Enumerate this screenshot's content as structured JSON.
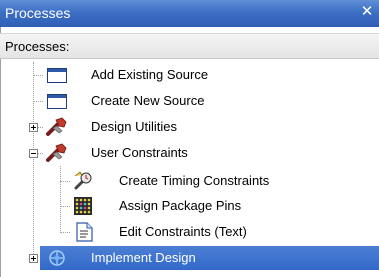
{
  "window": {
    "title": "Processes",
    "close_glyph": "✕"
  },
  "header": {
    "label": "Processes:"
  },
  "tree": {
    "items": [
      {
        "label": "Add Existing Source",
        "icon": "window-icon"
      },
      {
        "label": "Create New Source",
        "icon": "window-icon"
      },
      {
        "label": "Design Utilities",
        "icon": "tools-icon",
        "expander": "plus"
      },
      {
        "label": "User Constraints",
        "icon": "tools-icon",
        "expander": "minus"
      },
      {
        "label": "Create Timing Constraints",
        "icon": "timing-icon"
      },
      {
        "label": "Assign Package Pins",
        "icon": "chip-icon"
      },
      {
        "label": "Edit Constraints (Text)",
        "icon": "document-icon"
      },
      {
        "label": "Implement Design",
        "icon": "implement-icon",
        "expander": "plus",
        "selected": true
      }
    ]
  },
  "colors": {
    "titlebar": "#3d6fc4",
    "selection": "#3269c9"
  }
}
